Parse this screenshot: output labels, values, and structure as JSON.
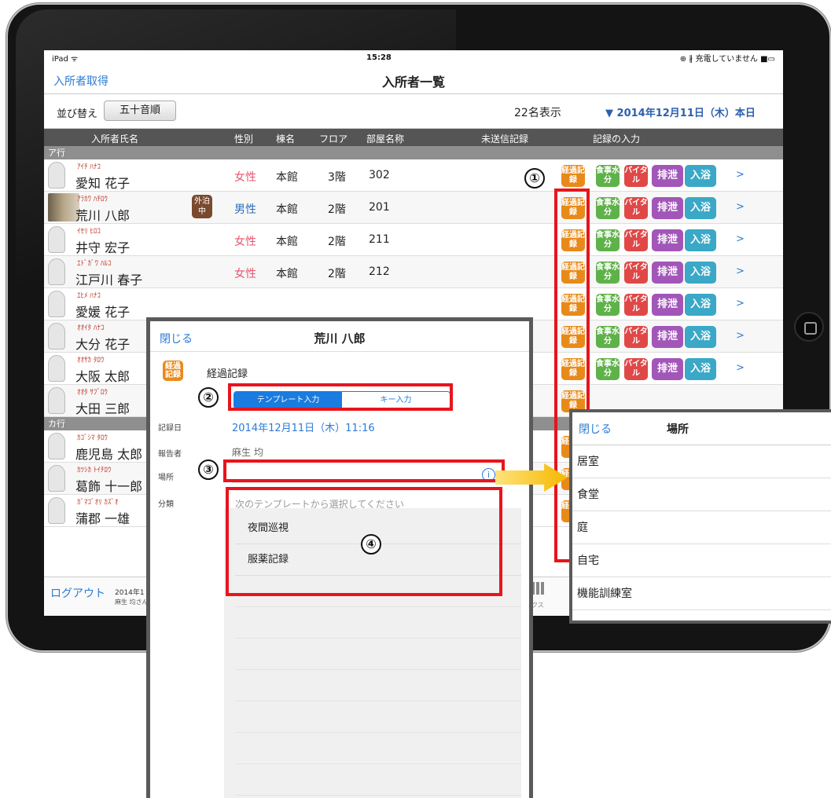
{
  "status": {
    "carrier": "iPad ᯤ",
    "time": "15:28",
    "battery": "⊕ ∦ 充電していません ■▭"
  },
  "nav": {
    "left": "入所者取得",
    "title": "入所者一覧"
  },
  "sortbar": {
    "label": "並び替え",
    "sort_button": "五十音順",
    "count": "22名表示",
    "date": "▼ 2014年12月11日（木）本日"
  },
  "columns": {
    "name": "入所者氏名",
    "gender": "性別",
    "building": "棟名",
    "floor": "フロア",
    "room": "部屋名称",
    "unsent": "未送信記録",
    "input": "記録の入力"
  },
  "sections": {
    "a": "ア行",
    "ka": "カ行"
  },
  "buttons": {
    "keika": "経過記録",
    "shoku": "食事水分",
    "vital": "バイタル",
    "haisetsu": "排泄",
    "nyuyoku": "入浴",
    "chevron": ">"
  },
  "rows": [
    {
      "kana": "ｱｲﾁ ﾊﾅｺ",
      "name": "愛知 花子",
      "gender": "女性",
      "building": "本館",
      "floor": "3階",
      "room": "302"
    },
    {
      "kana": "ｱﾗｶﾜ ﾊﾁﾛｳ",
      "name": "荒川 八郎",
      "gender": "男性",
      "building": "本館",
      "floor": "2階",
      "room": "201",
      "badge": "外泊中"
    },
    {
      "kana": "ｲｾﾘ ﾋﾛｺ",
      "name": "井守 宏子",
      "gender": "女性",
      "building": "本館",
      "floor": "2階",
      "room": "211"
    },
    {
      "kana": "ｴﾄﾞｶﾞﾜ ﾊﾙｺ",
      "name": "江戸川 春子",
      "gender": "女性",
      "building": "本館",
      "floor": "2階",
      "room": "212"
    },
    {
      "kana": "ｴﾋﾒ ﾊﾅｺ",
      "name": "愛媛 花子"
    },
    {
      "kana": "ｵｵｲﾀ ﾊﾅｺ",
      "name": "大分 花子"
    },
    {
      "kana": "ｵｵｻｶ ﾀﾛｳ",
      "name": "大阪 太郎"
    },
    {
      "kana": "ｵｵﾀ ｻﾌﾞﾛｳ",
      "name": "大田 三郎"
    },
    {
      "kana": "ｶｺﾞｼﾏ ﾀﾛｳ",
      "name": "鹿児島 太郎"
    },
    {
      "kana": "ｶﾂｼｶ ﾄｲﾁﾛｳ",
      "name": "葛飾 十一郎"
    },
    {
      "kana": "ｶﾞﾏｺﾞｵﾘ ｶｽﾞｵ",
      "name": "蒲郡 一雄"
    }
  ],
  "bottom": {
    "logout": "ログアウト",
    "date": "2014年1",
    "user": "麻生 均さん",
    "tab": "ックス"
  },
  "modal": {
    "close": "閉じる",
    "title": "荒川 八郎",
    "icon": "経過記録",
    "record_title": "経過記録",
    "seg_template": "テンプレート入力",
    "seg_key": "キー入力",
    "label_date": "記録日",
    "label_reporter": "報告者",
    "label_place": "場所",
    "label_category": "分類",
    "date": "2014年12月11日（木）11:16",
    "reporter": "麻生 均",
    "hint": "次のテンプレートから選択してください",
    "templates": [
      "夜間巡視",
      "服薬記録"
    ]
  },
  "popup": {
    "close": "閉じる",
    "title": "場所",
    "items": [
      "居室",
      "食堂",
      "庭",
      "自宅",
      "機能訓練室"
    ]
  },
  "annotations": {
    "n1": "①",
    "n2": "②",
    "n3": "③",
    "n4": "④"
  },
  "colors": {
    "accent": "#2b7bd6",
    "highlight": "#e8141c",
    "keika": "#e88a1a",
    "arrow": "#f5b800"
  }
}
